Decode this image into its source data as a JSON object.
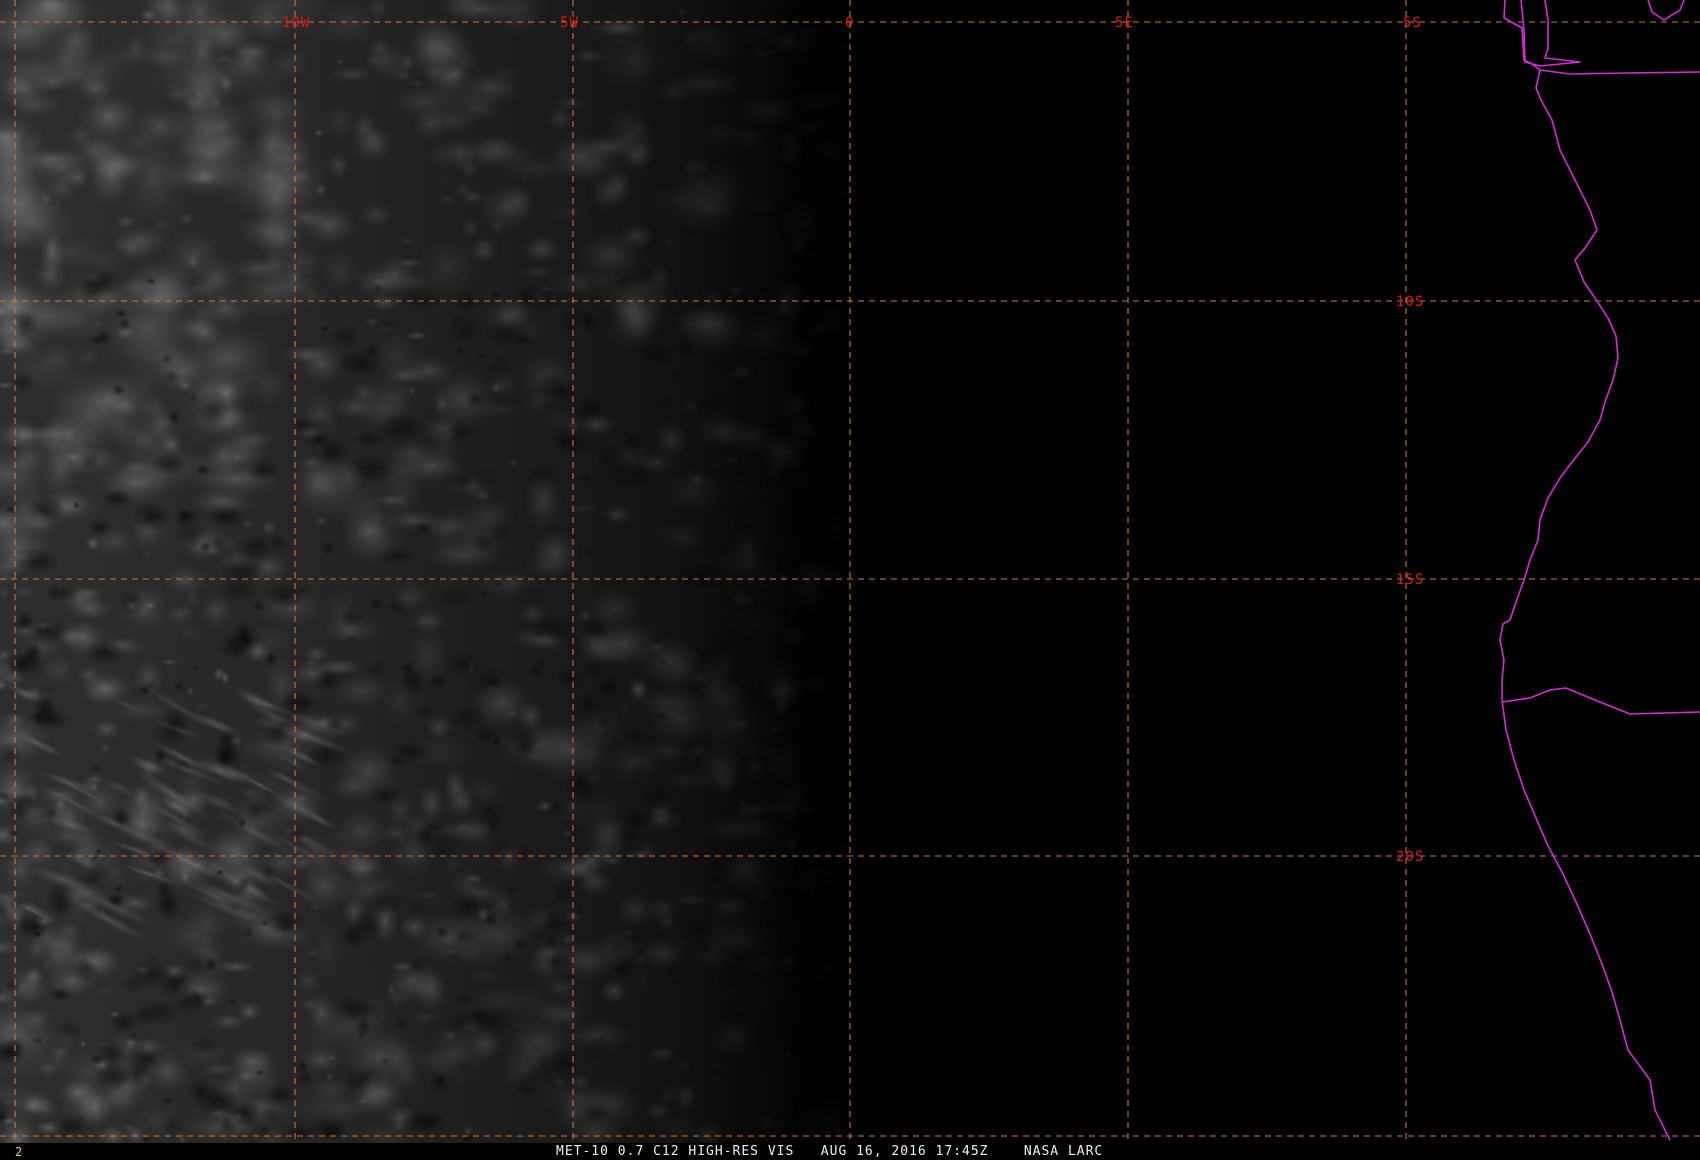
{
  "imagery": {
    "caption": "MET-10 0.7 C12 HIGH-RES VIS   AUG 16, 2016 17:45Z    NASA LARC",
    "frame_number": "2"
  },
  "grid": {
    "longitude_labels": [
      "10W",
      "5W",
      "0",
      "5E"
    ],
    "latitude_labels": [
      "5S",
      "10S",
      "15S",
      "20S"
    ],
    "line_color": "#c07a4a",
    "label_color": "#e01818"
  },
  "boundaries": {
    "color": "#d62ad6"
  }
}
